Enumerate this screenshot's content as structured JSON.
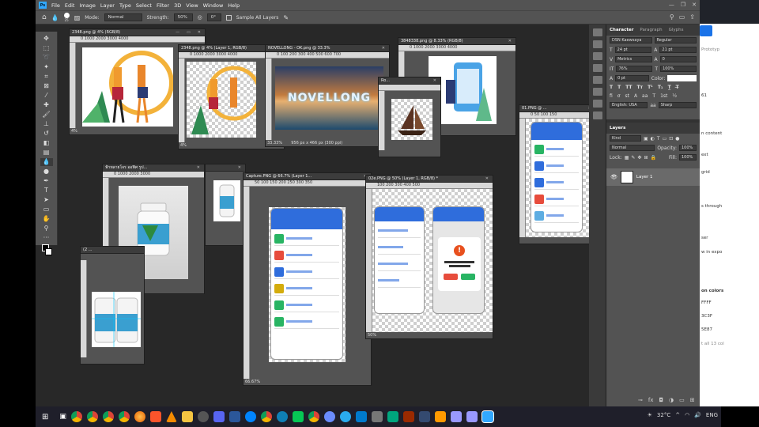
{
  "menubar": {
    "items": [
      "File",
      "Edit",
      "Image",
      "Layer",
      "Type",
      "Select",
      "Filter",
      "3D",
      "View",
      "Window",
      "Help"
    ]
  },
  "options": {
    "brush_size": "25",
    "mode_label": "Mode:",
    "mode_value": "Normal",
    "strength_label": "Strength:",
    "strength_value": "50%",
    "angle_value": "0°",
    "sample_all": "Sample All Layers"
  },
  "documents": [
    {
      "title": "2348.png @ 4% (RGB/8)",
      "ruler": "0   1000  2000  3000  4000",
      "status": "4%"
    },
    {
      "title": "2348.png @ 4% (Layer 1, RGB/8)",
      "ruler": "0  1000 2000 3000 4000",
      "status": "4%"
    },
    {
      "title": "NOVELLONG - OK.png @ 33.3%",
      "ruler": "0  100  200  300  400  500  600  700",
      "status": "33.33%",
      "dims": "956 px x 466 px (300 ppi)",
      "art_text": "NOVELLONG"
    },
    {
      "title": "Ro...",
      "ruler": ""
    },
    {
      "title": "3848338.png @ 8.33% (RGB/8)",
      "ruler": "0 1000 2000 3000 4000"
    },
    {
      "title": "01.PNG @ ...",
      "ruler": "0  50  100  150"
    },
    {
      "title": "ฟ้าทลายโจร ออฟิศ รูป...",
      "ruler": "0  1000  2000  3000",
      "status": "5%"
    },
    {
      "title": "Capture.PNG @ 66.7% (Layer 1...",
      "ruler": "50  100  150  200  250  300  350",
      "status": "66.67%"
    },
    {
      "title": "02e.PNG @ 50% (Layer 1, RGB/8) *",
      "ruler": "100  200  300  400  500",
      "status": "50%"
    },
    {
      "title": "(2 ...",
      "ruler": ""
    }
  ],
  "character": {
    "tabs": [
      "Character",
      "Paragraph",
      "Glyphs"
    ],
    "font": "DSN Kaewsaya",
    "style": "Regular",
    "size": "24 pt",
    "leading": "21 pt",
    "kerning": "Metrics",
    "tracking": "0",
    "vscale": "76%",
    "hscale": "100%",
    "baseline": "0 pt",
    "color_label": "Color:",
    "language": "English: USA",
    "aa": "Sharp"
  },
  "layers": {
    "tab": "Layers",
    "kind": "Kind",
    "blend": "Normal",
    "opacity_label": "Opacity:",
    "opacity": "100%",
    "lock_label": "Lock:",
    "fill_label": "Fill:",
    "fill": "100%",
    "layer_name": "Layer 1"
  },
  "browser": {
    "lines": [
      "Prototyp",
      "61",
      "n content",
      "ext",
      "grid",
      "s through",
      "ser",
      "w in expo",
      "on colors",
      "FFFF",
      "3C3F",
      "5E87",
      "t all 13 col"
    ]
  },
  "taskbar": {
    "weather": "32°C",
    "lang": "ENG"
  }
}
